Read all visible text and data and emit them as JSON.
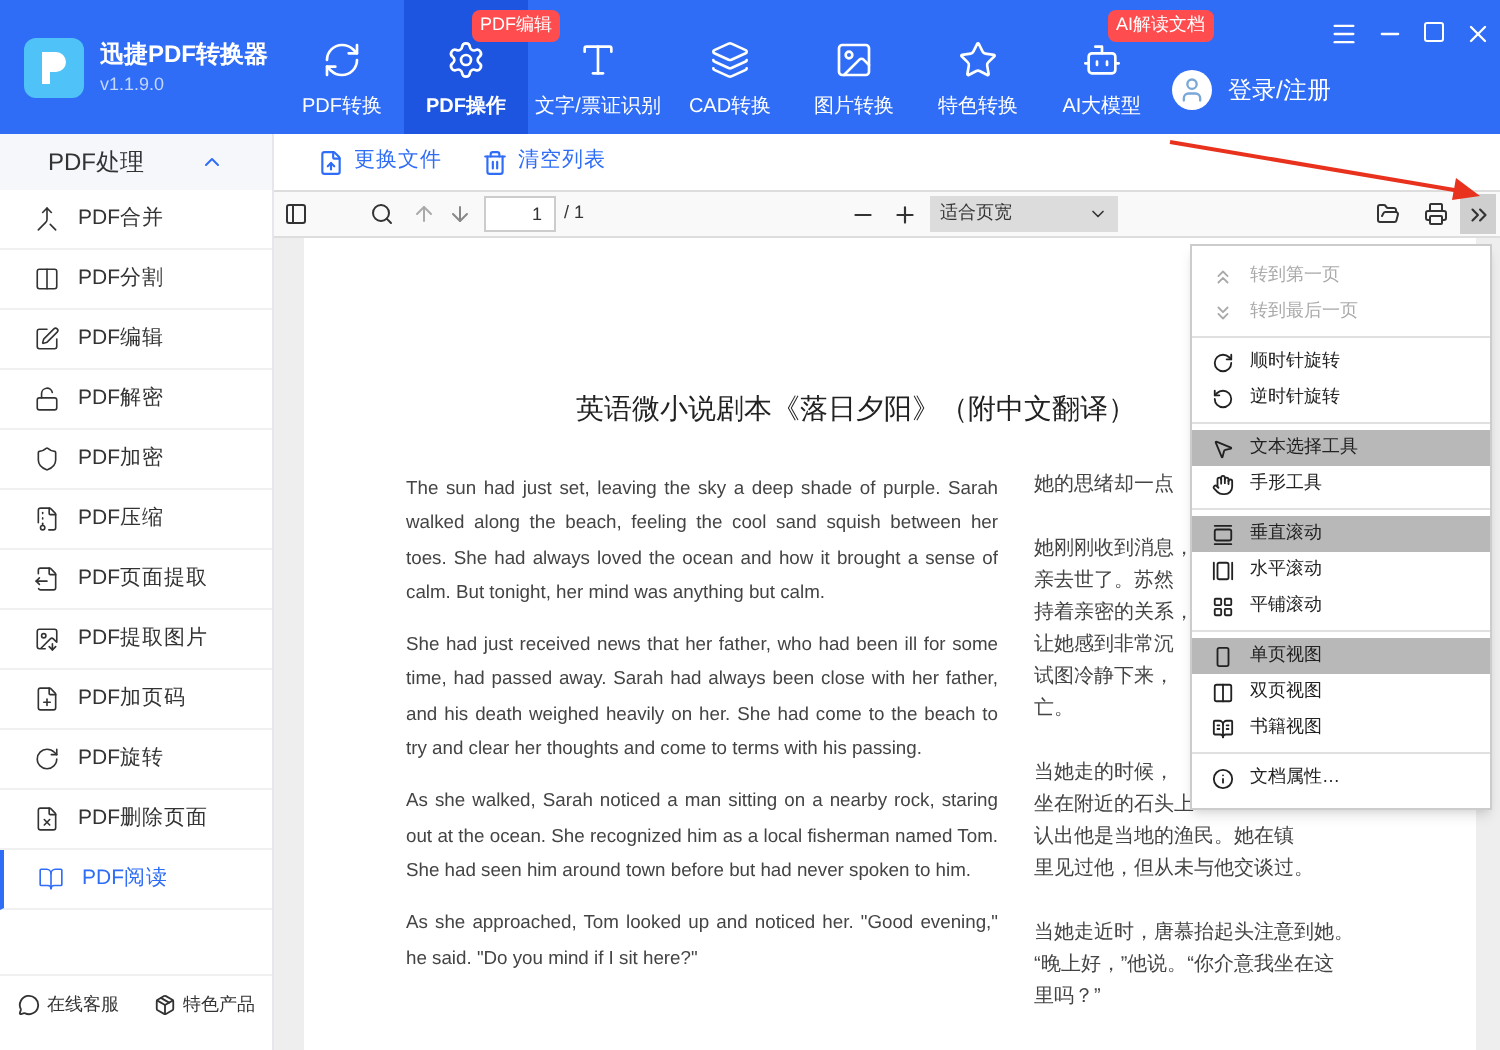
{
  "app": {
    "name": "迅捷PDF转换器",
    "version": "v1.1.9.0"
  },
  "nav": [
    {
      "label": "PDF转换",
      "selected": false
    },
    {
      "label": "PDF操作",
      "selected": true,
      "badge": "PDF编辑"
    },
    {
      "label": "文字/票证识别",
      "selected": false
    },
    {
      "label": "CAD转换",
      "selected": false
    },
    {
      "label": "图片转换",
      "selected": false
    },
    {
      "label": "特色转换",
      "selected": false
    },
    {
      "label": "AI大模型",
      "selected": false,
      "badge": "AI解读文档"
    }
  ],
  "login": "登录/注册",
  "sidebar": {
    "title": "PDF处理",
    "expanded": true,
    "items": [
      {
        "label": "PDF合并",
        "selected": false
      },
      {
        "label": "PDF分割",
        "selected": false
      },
      {
        "label": "PDF编辑",
        "selected": false
      },
      {
        "label": "PDF解密",
        "selected": false
      },
      {
        "label": "PDF加密",
        "selected": false
      },
      {
        "label": "PDF压缩",
        "selected": false
      },
      {
        "label": "PDF页面提取",
        "selected": false
      },
      {
        "label": "PDF提取图片",
        "selected": false
      },
      {
        "label": "PDF加页码",
        "selected": false
      },
      {
        "label": "PDF旋转",
        "selected": false
      },
      {
        "label": "PDF删除页面",
        "selected": false
      },
      {
        "label": "PDF阅读",
        "selected": true
      }
    ],
    "footer": [
      "在线客服",
      "特色产品"
    ]
  },
  "actions": [
    "更换文件",
    "清空列表"
  ],
  "viewer_toolbar": {
    "page": "1",
    "page_total": "/ 1",
    "zoom": "适合页宽",
    "more_selected": true
  },
  "document": {
    "title": "英语微小说剧本《落日夕阳》（附中文翻译）",
    "paragraphs": [
      "The sun had just set, leaving the sky a deep shade of purple. Sarah walked along the beach, feeling the cool sand squish between her toes. She had always loved the ocean and how it brought a sense of calm. But tonight, her mind was anything but calm.",
      "She had just received news that her father, who had been ill for some time, had passed away. Sarah had always been close with her father, and his death weighed heavily on her. She had come to the beach to try and clear her thoughts and come to terms with his passing.",
      "As she walked, Sarah noticed a man sitting on a nearby rock, staring out at the ocean. She recognized him as a local fisherman named Tom. She had seen him around town before but had never spoken to him.",
      "As she approached, Tom looked up and noticed her. \"Good evening,\" he said. \"Do you mind if I sit here?\""
    ],
    "translation": [
      [
        "她的思绪却一点"
      ],
      [
        "她刚刚收到消息，",
        "亲去世了。苏然",
        "持着亲密的关系，",
        "让她感到非常沉",
        "试图冷静下来，",
        "亡。"
      ],
      [
        "当她走的时候，",
        "坐在附近的石头上",
        "认出他是当地的渔民。她在镇",
        "里见过他，但从未与他交谈过。"
      ],
      [
        "当她走近时，唐慕抬起头注意到她。",
        "“晚上好，”他说。“你介意我坐在这",
        "里吗？”"
      ]
    ]
  },
  "menu": [
    [
      {
        "label": "转到第一页",
        "disabled": true,
        "selected": false
      },
      {
        "label": "转到最后一页",
        "disabled": true,
        "selected": false
      }
    ],
    [
      {
        "label": "顺时针旋转",
        "disabled": false,
        "selected": false
      },
      {
        "label": "逆时针旋转",
        "disabled": false,
        "selected": false
      }
    ],
    [
      {
        "label": "文本选择工具",
        "disabled": false,
        "selected": true
      },
      {
        "label": "手形工具",
        "disabled": false,
        "selected": false
      }
    ],
    [
      {
        "label": "垂直滚动",
        "disabled": false,
        "selected": true
      },
      {
        "label": "水平滚动",
        "disabled": false,
        "selected": false
      },
      {
        "label": "平铺滚动",
        "disabled": false,
        "selected": false
      }
    ],
    [
      {
        "label": "单页视图",
        "disabled": false,
        "selected": true
      },
      {
        "label": "双页视图",
        "disabled": false,
        "selected": false
      },
      {
        "label": "书籍视图",
        "disabled": false,
        "selected": false
      }
    ],
    [
      {
        "label": "文档属性…",
        "disabled": false,
        "selected": false
      }
    ]
  ]
}
